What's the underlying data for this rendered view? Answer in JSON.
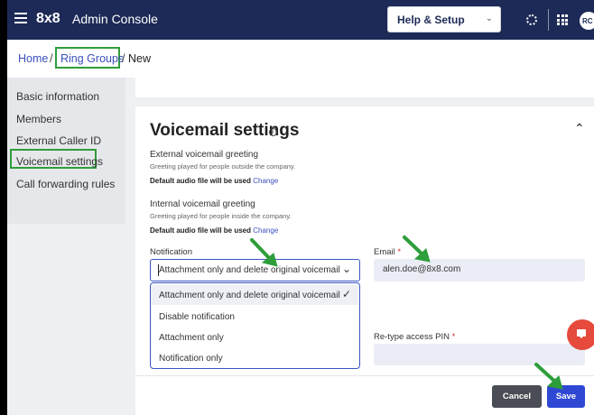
{
  "header": {
    "brand": "8x8",
    "app_name": "Admin Console",
    "help_menu": "Help & Setup",
    "avatar_initials": "RC"
  },
  "breadcrumb": {
    "home": "Home",
    "ring_groups": "Ring Groups",
    "current": "New",
    "separator": "/"
  },
  "sidebar": {
    "items": [
      {
        "label": "Basic information"
      },
      {
        "label": "Members"
      },
      {
        "label": "External Caller ID"
      },
      {
        "label": "Voicemail settings"
      },
      {
        "label": "Call forwarding rules"
      }
    ]
  },
  "voicemail": {
    "title": "Voicemail settings",
    "external_greeting_label": "External voicemail greeting",
    "external_greeting_desc": "Greeting played for people outside the company.",
    "internal_greeting_label": "Internal voicemail greeting",
    "internal_greeting_desc": "Greeting played for people inside the company.",
    "default_audio": "Default audio file will be used",
    "change_link": "Change",
    "notification_label": "Notification",
    "notification_value": "Attachment only and delete original voicemail",
    "notification_options": [
      {
        "label": "Attachment only and delete original voicemail"
      },
      {
        "label": "Disable notification"
      },
      {
        "label": "Attachment only"
      },
      {
        "label": "Notification only"
      }
    ],
    "email_label": "Email",
    "email_value": "alen.doe@8x8.com",
    "pin_label": "Re-type access PIN",
    "required_mark": "*"
  },
  "actions": {
    "cancel": "Cancel",
    "save": "Save"
  },
  "colors": {
    "header_bg": "#1d2a57",
    "accent": "#2f48d4",
    "highlight_box": "#2e9e3a",
    "arrow": "#2e9e3a",
    "fab": "#e54a3c"
  }
}
